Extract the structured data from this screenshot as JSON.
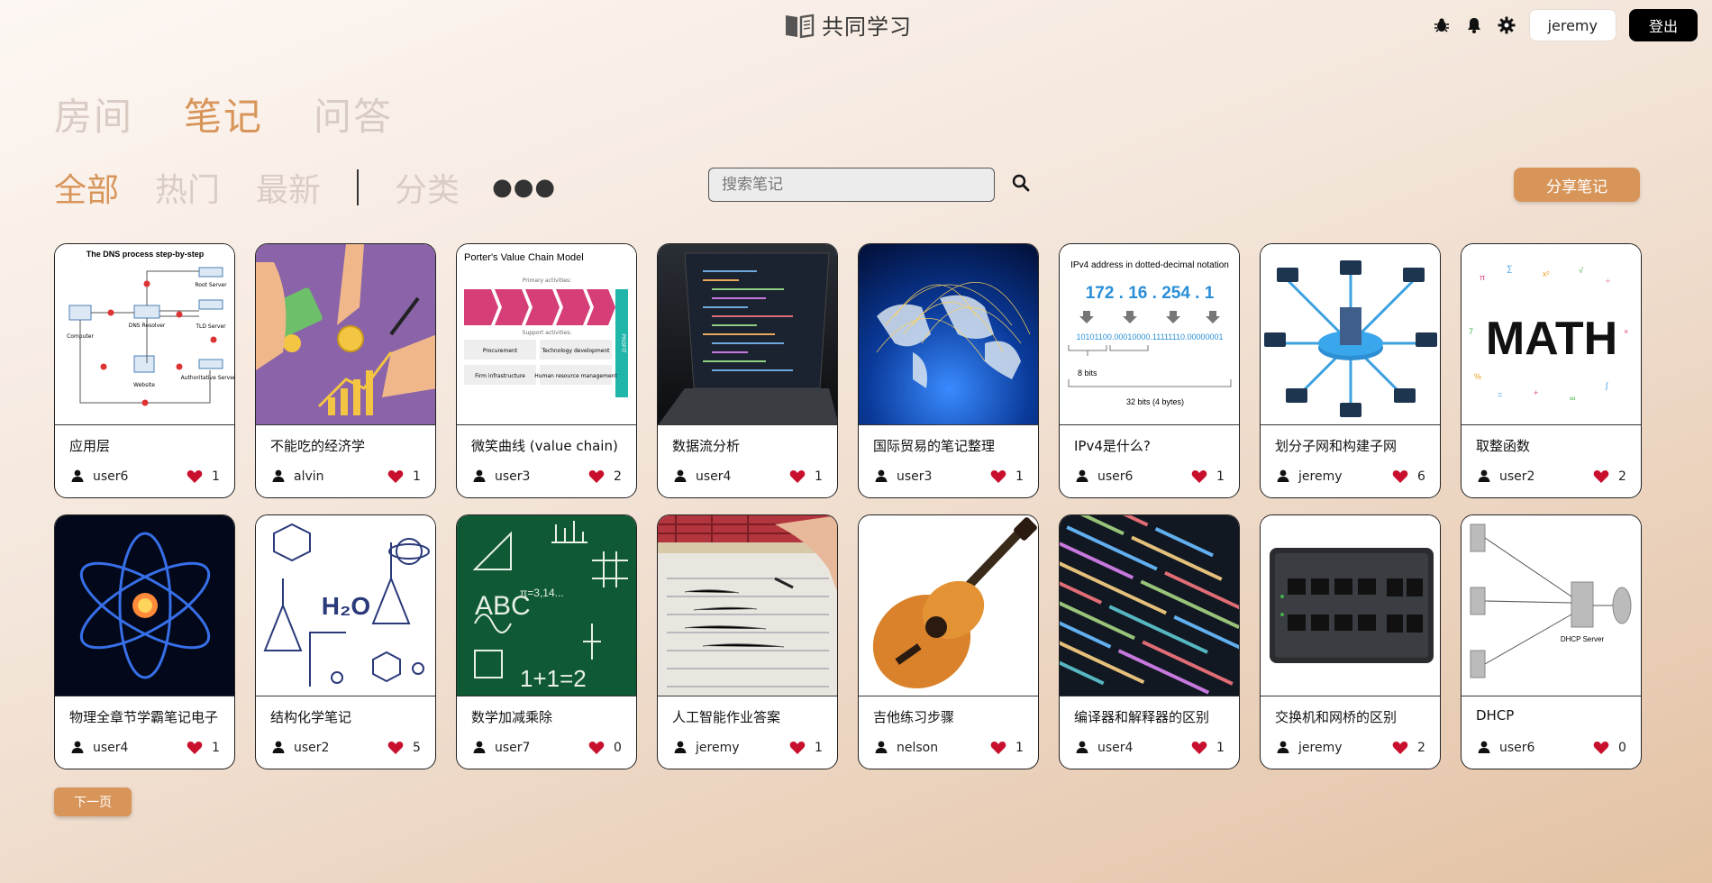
{
  "header": {
    "brand": "共同学习",
    "username": "jeremy",
    "logout_label": "登出"
  },
  "main_tabs": [
    "房间",
    "笔记",
    "问答"
  ],
  "sub_tabs": [
    "全部",
    "热门",
    "最新"
  ],
  "category_label": "分类",
  "search": {
    "placeholder": "搜索笔记"
  },
  "share_label": "分享笔记",
  "next_label": "下一页",
  "colors": {
    "accent": "#d8955a",
    "heart": "#c8102e"
  },
  "notes": [
    {
      "title": "应用层",
      "user": "user6",
      "likes": "1",
      "thumb": "dns-diagram"
    },
    {
      "title": "不能吃的经济学",
      "user": "alvin",
      "likes": "1",
      "thumb": "economics-illustration"
    },
    {
      "title": "微笑曲线 (value chain)",
      "user": "user3",
      "likes": "2",
      "thumb": "value-chain-diagram"
    },
    {
      "title": "数据流分析",
      "user": "user4",
      "likes": "1",
      "thumb": "laptop-code-photo"
    },
    {
      "title": "国际贸易的笔记整理",
      "user": "user3",
      "likes": "1",
      "thumb": "world-network-image"
    },
    {
      "title": "IPv4是什么?",
      "user": "user6",
      "likes": "1",
      "thumb": "ipv4-diagram"
    },
    {
      "title": "划分子网和构建子网",
      "user": "jeremy",
      "likes": "6",
      "thumb": "network-topology"
    },
    {
      "title": "取整函数",
      "user": "user2",
      "likes": "2",
      "thumb": "math-word-art"
    },
    {
      "title": "物理全章节学霸笔记电子",
      "user": "user4",
      "likes": "1",
      "thumb": "atom-image"
    },
    {
      "title": "结构化学笔记",
      "user": "user2",
      "likes": "5",
      "thumb": "chemistry-doodle"
    },
    {
      "title": "数学加减乘除",
      "user": "user7",
      "likes": "0",
      "thumb": "chalkboard-math"
    },
    {
      "title": "人工智能作业答案",
      "user": "jeremy",
      "likes": "1",
      "thumb": "writing-notes-photo"
    },
    {
      "title": "吉他练习步骤",
      "user": "nelson",
      "likes": "1",
      "thumb": "guitar-photo"
    },
    {
      "title": "编译器和解释器的区别",
      "user": "user4",
      "likes": "1",
      "thumb": "code-screen-photo"
    },
    {
      "title": "交换机和网桥的区别",
      "user": "jeremy",
      "likes": "2",
      "thumb": "network-switch-photo"
    },
    {
      "title": "DHCP",
      "user": "user6",
      "likes": "0",
      "thumb": "dhcp-diagram"
    }
  ],
  "thumb_text": {
    "dns": {
      "title": "The DNS process step-by-step",
      "computer": "Computer",
      "resolver": "DNS Resolver",
      "root": "Root Server",
      "tld": "TLD Server",
      "website": "Website",
      "auth": "Authoritative Server"
    },
    "value_chain": {
      "title": "Porter's Value Chain Model",
      "primary": "Primary activities:",
      "support": "Support activities:",
      "procurement": "Procurement",
      "tech": "Technology development",
      "firm": "Firm infrastructure",
      "hr": "Human resource management",
      "profit": "PROFIT"
    },
    "ipv4": {
      "title": "IPv4 address in dotted-decimal notation",
      "octets": "172  .  16  . 254  .  1",
      "binary": "10101100.00010000.11111110.00000001",
      "bits8": "8 bits",
      "bits32": "32 bits (4 bytes)"
    },
    "math": "MATH",
    "chem": "H₂O",
    "chalk": "ABC",
    "chalk2": "1+1=2",
    "dhcp": "DHCP Server"
  }
}
